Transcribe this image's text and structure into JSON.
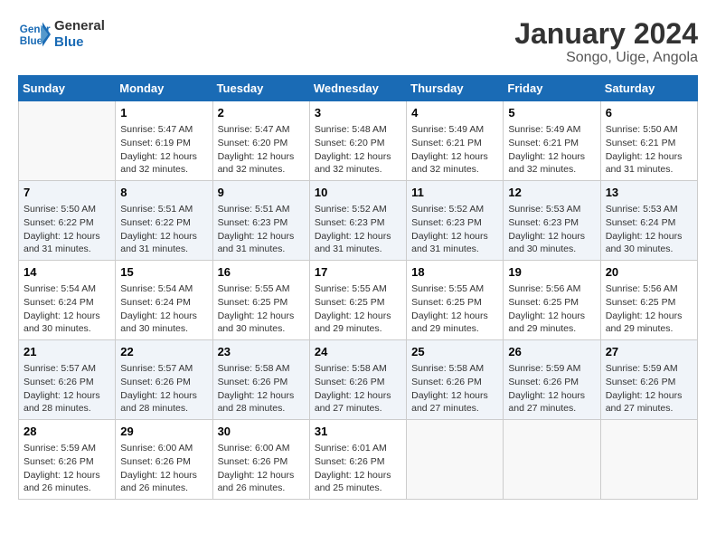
{
  "header": {
    "logo_line1": "General",
    "logo_line2": "Blue",
    "title": "January 2024",
    "subtitle": "Songo, Uige, Angola"
  },
  "days_header": [
    "Sunday",
    "Monday",
    "Tuesday",
    "Wednesday",
    "Thursday",
    "Friday",
    "Saturday"
  ],
  "weeks": [
    [
      {
        "num": "",
        "info": ""
      },
      {
        "num": "1",
        "info": "Sunrise: 5:47 AM\nSunset: 6:19 PM\nDaylight: 12 hours\nand 32 minutes."
      },
      {
        "num": "2",
        "info": "Sunrise: 5:47 AM\nSunset: 6:20 PM\nDaylight: 12 hours\nand 32 minutes."
      },
      {
        "num": "3",
        "info": "Sunrise: 5:48 AM\nSunset: 6:20 PM\nDaylight: 12 hours\nand 32 minutes."
      },
      {
        "num": "4",
        "info": "Sunrise: 5:49 AM\nSunset: 6:21 PM\nDaylight: 12 hours\nand 32 minutes."
      },
      {
        "num": "5",
        "info": "Sunrise: 5:49 AM\nSunset: 6:21 PM\nDaylight: 12 hours\nand 32 minutes."
      },
      {
        "num": "6",
        "info": "Sunrise: 5:50 AM\nSunset: 6:21 PM\nDaylight: 12 hours\nand 31 minutes."
      }
    ],
    [
      {
        "num": "7",
        "info": "Sunrise: 5:50 AM\nSunset: 6:22 PM\nDaylight: 12 hours\nand 31 minutes."
      },
      {
        "num": "8",
        "info": "Sunrise: 5:51 AM\nSunset: 6:22 PM\nDaylight: 12 hours\nand 31 minutes."
      },
      {
        "num": "9",
        "info": "Sunrise: 5:51 AM\nSunset: 6:23 PM\nDaylight: 12 hours\nand 31 minutes."
      },
      {
        "num": "10",
        "info": "Sunrise: 5:52 AM\nSunset: 6:23 PM\nDaylight: 12 hours\nand 31 minutes."
      },
      {
        "num": "11",
        "info": "Sunrise: 5:52 AM\nSunset: 6:23 PM\nDaylight: 12 hours\nand 31 minutes."
      },
      {
        "num": "12",
        "info": "Sunrise: 5:53 AM\nSunset: 6:23 PM\nDaylight: 12 hours\nand 30 minutes."
      },
      {
        "num": "13",
        "info": "Sunrise: 5:53 AM\nSunset: 6:24 PM\nDaylight: 12 hours\nand 30 minutes."
      }
    ],
    [
      {
        "num": "14",
        "info": "Sunrise: 5:54 AM\nSunset: 6:24 PM\nDaylight: 12 hours\nand 30 minutes."
      },
      {
        "num": "15",
        "info": "Sunrise: 5:54 AM\nSunset: 6:24 PM\nDaylight: 12 hours\nand 30 minutes."
      },
      {
        "num": "16",
        "info": "Sunrise: 5:55 AM\nSunset: 6:25 PM\nDaylight: 12 hours\nand 30 minutes."
      },
      {
        "num": "17",
        "info": "Sunrise: 5:55 AM\nSunset: 6:25 PM\nDaylight: 12 hours\nand 29 minutes."
      },
      {
        "num": "18",
        "info": "Sunrise: 5:55 AM\nSunset: 6:25 PM\nDaylight: 12 hours\nand 29 minutes."
      },
      {
        "num": "19",
        "info": "Sunrise: 5:56 AM\nSunset: 6:25 PM\nDaylight: 12 hours\nand 29 minutes."
      },
      {
        "num": "20",
        "info": "Sunrise: 5:56 AM\nSunset: 6:25 PM\nDaylight: 12 hours\nand 29 minutes."
      }
    ],
    [
      {
        "num": "21",
        "info": "Sunrise: 5:57 AM\nSunset: 6:26 PM\nDaylight: 12 hours\nand 28 minutes."
      },
      {
        "num": "22",
        "info": "Sunrise: 5:57 AM\nSunset: 6:26 PM\nDaylight: 12 hours\nand 28 minutes."
      },
      {
        "num": "23",
        "info": "Sunrise: 5:58 AM\nSunset: 6:26 PM\nDaylight: 12 hours\nand 28 minutes."
      },
      {
        "num": "24",
        "info": "Sunrise: 5:58 AM\nSunset: 6:26 PM\nDaylight: 12 hours\nand 27 minutes."
      },
      {
        "num": "25",
        "info": "Sunrise: 5:58 AM\nSunset: 6:26 PM\nDaylight: 12 hours\nand 27 minutes."
      },
      {
        "num": "26",
        "info": "Sunrise: 5:59 AM\nSunset: 6:26 PM\nDaylight: 12 hours\nand 27 minutes."
      },
      {
        "num": "27",
        "info": "Sunrise: 5:59 AM\nSunset: 6:26 PM\nDaylight: 12 hours\nand 27 minutes."
      }
    ],
    [
      {
        "num": "28",
        "info": "Sunrise: 5:59 AM\nSunset: 6:26 PM\nDaylight: 12 hours\nand 26 minutes."
      },
      {
        "num": "29",
        "info": "Sunrise: 6:00 AM\nSunset: 6:26 PM\nDaylight: 12 hours\nand 26 minutes."
      },
      {
        "num": "30",
        "info": "Sunrise: 6:00 AM\nSunset: 6:26 PM\nDaylight: 12 hours\nand 26 minutes."
      },
      {
        "num": "31",
        "info": "Sunrise: 6:01 AM\nSunset: 6:26 PM\nDaylight: 12 hours\nand 25 minutes."
      },
      {
        "num": "",
        "info": ""
      },
      {
        "num": "",
        "info": ""
      },
      {
        "num": "",
        "info": ""
      }
    ]
  ]
}
